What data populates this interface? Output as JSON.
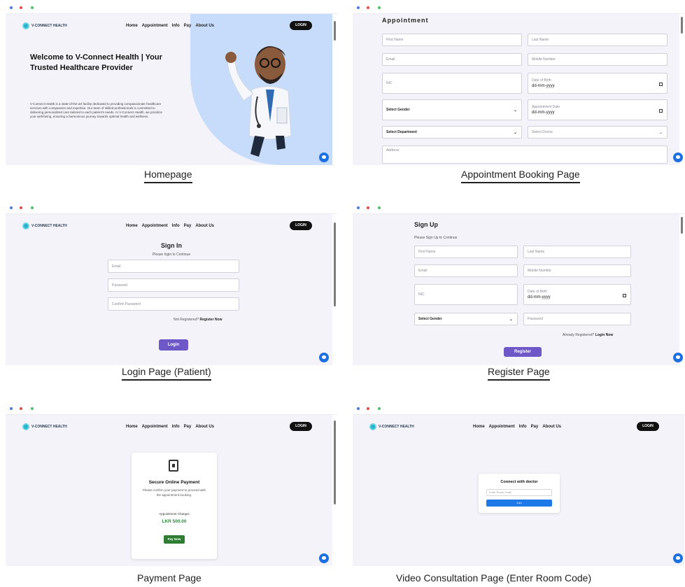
{
  "nav": {
    "links": [
      "Home",
      "Appointment",
      "Info",
      "Pay",
      "About Us"
    ],
    "login_label": "LOGIN",
    "logo_text": "V-CONNECT HEALTH"
  },
  "captions": {
    "homepage": "Homepage",
    "appointment": "Appointment Booking Page",
    "login": "Login Page (Patient)",
    "register": "Register Page",
    "payment": "Payment Page",
    "video": "Video Consultation Page (Enter Room Code)"
  },
  "homepage": {
    "title": "Welcome to V-Connect Health | Your Trusted Healthcare Provider",
    "body": "V-Connect Health is a state-of-the-art facility dedicated to providing compassionate healthcare services with compassion and expertise. Our team of skilled professionals is committed to delivering personalized care tailored to each patient's needs. At V-Connect Health, we prioritize your well-being, ensuring a harmonious journey towards optimal health and wellness."
  },
  "appointment": {
    "title": "Appointment",
    "first_name": "First Name",
    "last_name": "Last Name",
    "email": "Email",
    "mobile": "Mobile Number",
    "nic": "NIC",
    "dob_label": "Date of Birth",
    "date_placeholder": "dd-mm-yyyy",
    "gender": "Select Gender",
    "appt_date_label": "Appointment Date",
    "department": "Select Department",
    "doctor": "Select Doctor",
    "address": "Address"
  },
  "login": {
    "title": "Sign In",
    "subtitle": "Please login to Continue",
    "email": "Email",
    "password": "Password",
    "confirm": "Confirm Password",
    "not_registered": "Not Registered?",
    "register_now": "Register Now",
    "button": "Login"
  },
  "register": {
    "title": "Sign Up",
    "subtitle": "Please Sign Up to Continue",
    "first_name": "First Name",
    "last_name": "Last Name",
    "email": "Email",
    "mobile": "Mobile Number",
    "nic": "NIC",
    "dob_label": "Date of Birth",
    "date_placeholder": "dd-mm-yyyy",
    "gender": "Select Gender",
    "password": "Password",
    "already": "Already Registered?",
    "login_now": "Login Now",
    "button": "Register"
  },
  "payment": {
    "title": "Secure Online Payment",
    "desc": "Please confirm your payment to proceed with the appointment booking.",
    "charges_label": "Appointment Charges",
    "amount": "LKR 500.00",
    "button": "Pay Now"
  },
  "video": {
    "title": "Connect with doctor",
    "placeholder": "Enter Room Code",
    "button": "Join"
  },
  "colors": {
    "accent": "#6e58c8",
    "join_blue": "#1e79e8",
    "pay_green": "#2e7d32",
    "hero_blue": "#c7dcfb"
  }
}
